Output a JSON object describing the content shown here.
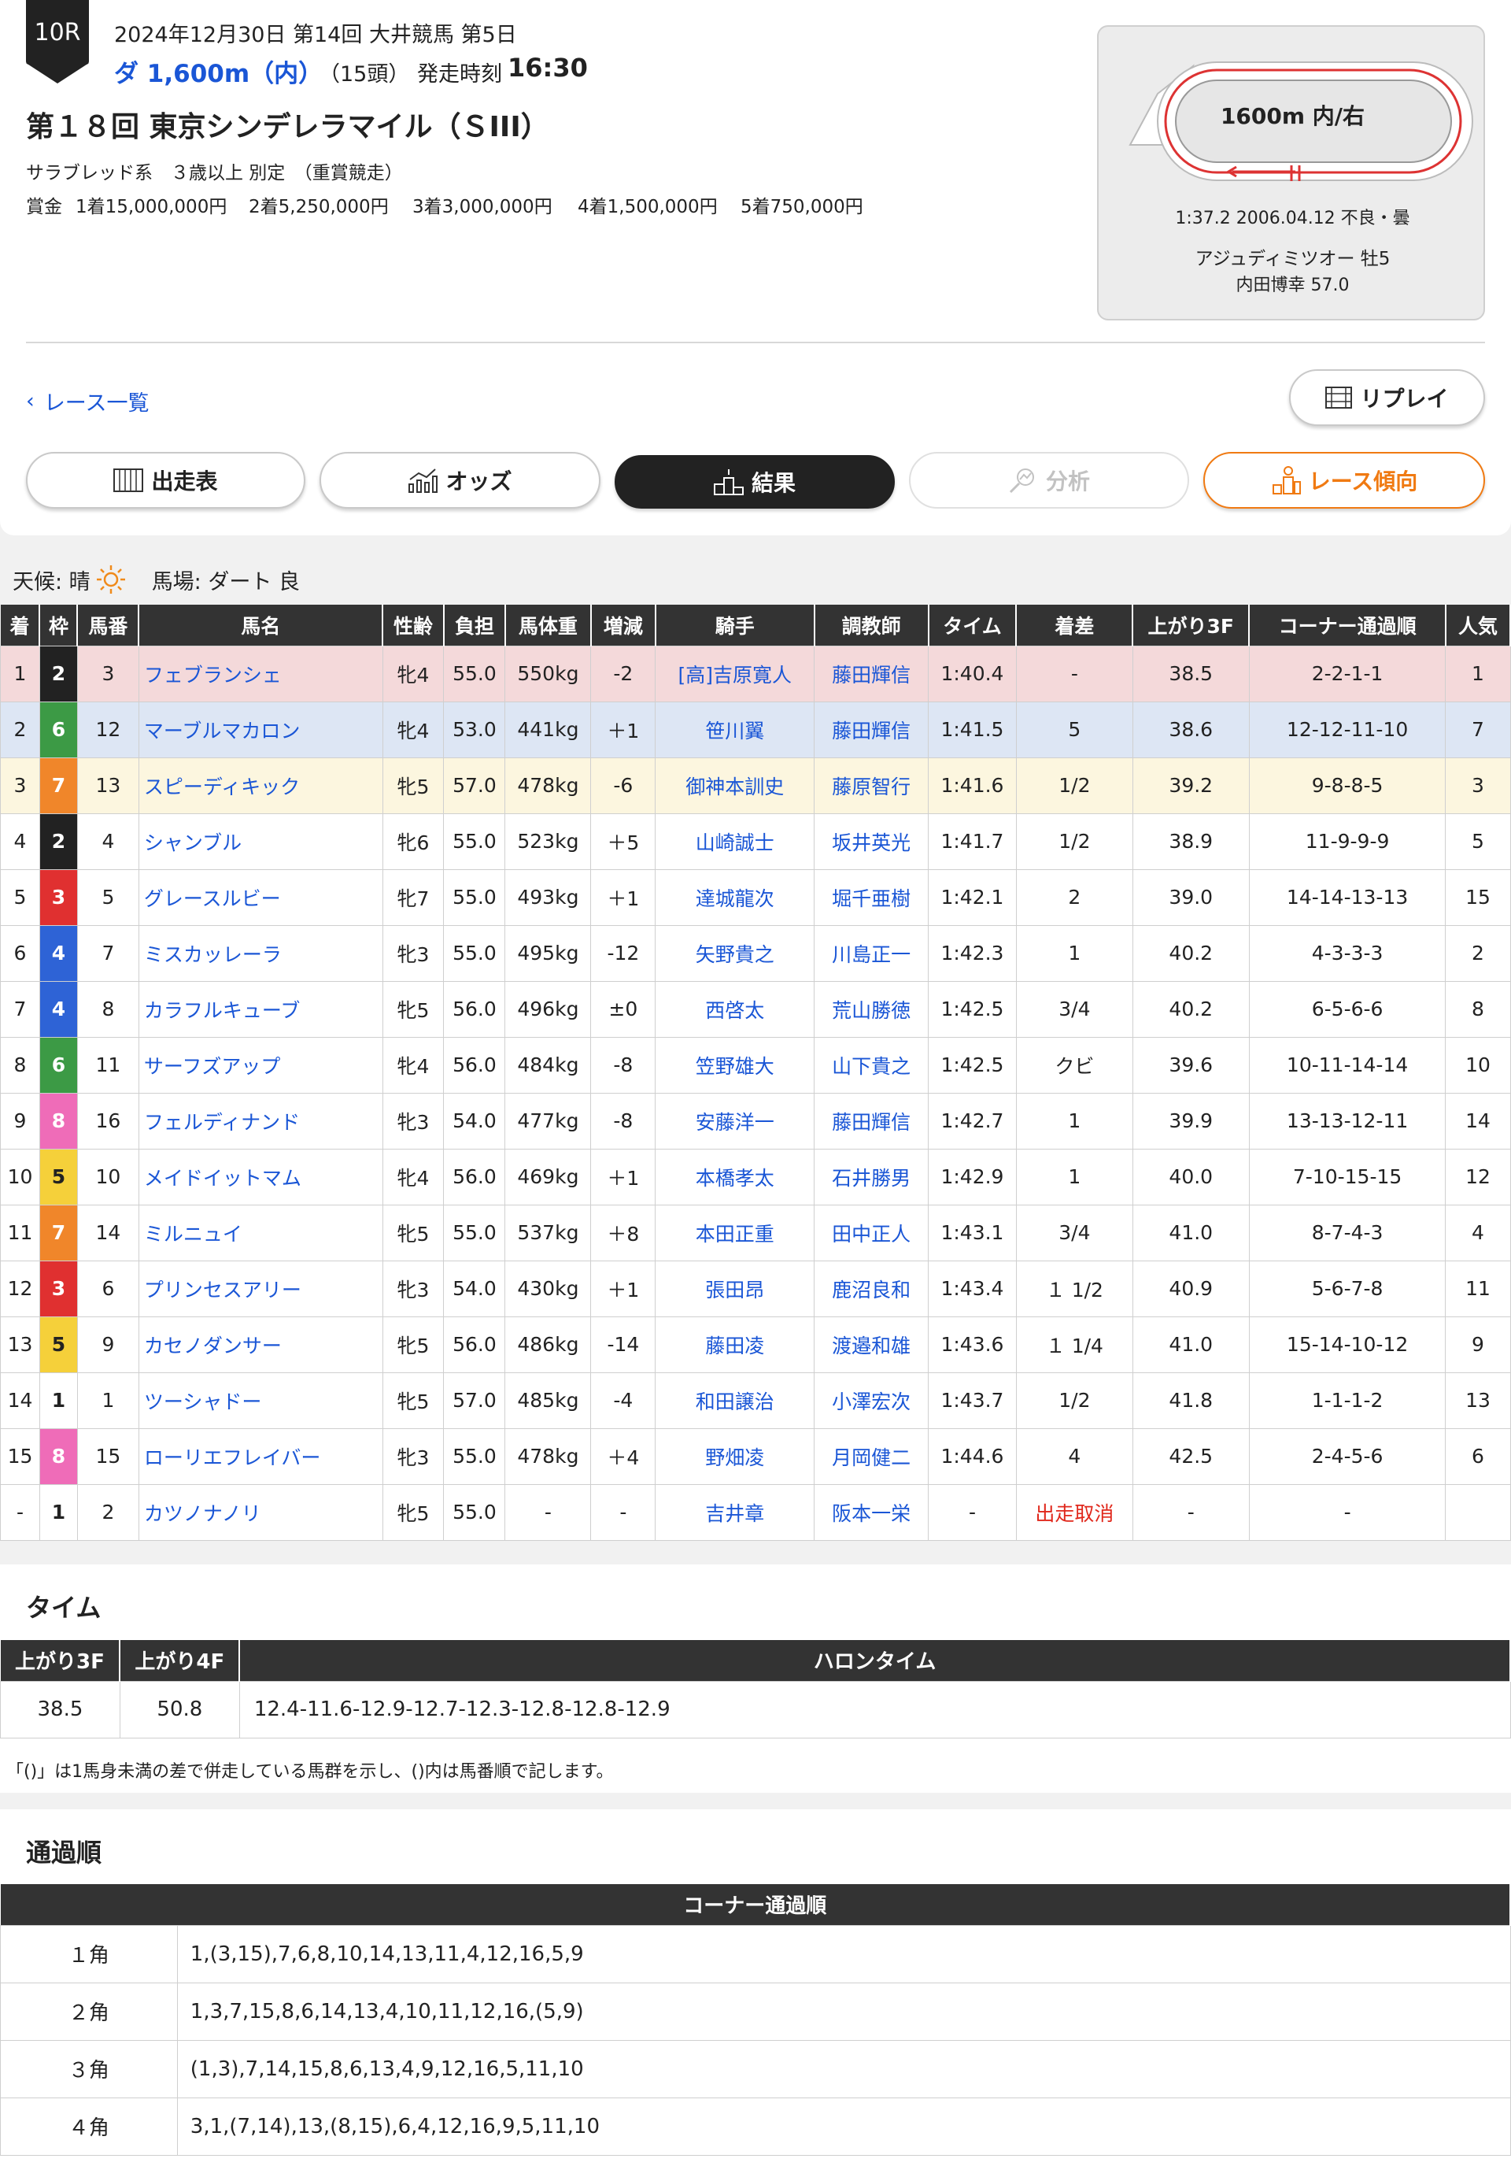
{
  "race": {
    "number": "10R",
    "date_line": "2024年12月30日  第14回 大井競馬 第5日",
    "course": "ダ 1,600m（内）",
    "field_size": "（15頭）",
    "start_label": "発走時刻",
    "start_time": "16:30",
    "title": "第１８回 東京シンデレラマイル（ＳIII）",
    "conditions": "サラブレッド系　３歳以上  別定　（重賞競走）",
    "prize_label": "賞金",
    "prizes": [
      "1着15,000,000円",
      "2着5,250,000円",
      "3着3,000,000円",
      "4着1,500,000円",
      "5着750,000円"
    ]
  },
  "course_record": {
    "track_label": "1600m 内/右",
    "time_line": "1:37.2   2006.04.12   不良・曇",
    "horse_line": "アジュディミツオー   牡5",
    "jockey_line": "内田博幸   57.0"
  },
  "nav": {
    "back_label": "レース一覧",
    "replay_label": "リプレイ",
    "tabs": [
      "出走表",
      "オッズ",
      "結果",
      "分析",
      "レース傾向"
    ]
  },
  "conditions_bar": {
    "weather_label": "天候: 晴",
    "track_label": "馬場: ダート 良"
  },
  "results": {
    "headers": [
      "着",
      "枠",
      "馬番",
      "馬名",
      "性齢",
      "負担",
      "馬体重",
      "増減",
      "騎手",
      "調教師",
      "タイム",
      "着差",
      "上がり3F",
      "コーナー通過順",
      "人気"
    ],
    "rows": [
      [
        "1",
        "2",
        "3",
        "フェブランシェ",
        "牝4",
        "55.0",
        "550kg",
        "-2",
        "[高]吉原寛人",
        "藤田輝信",
        "1:40.4",
        "-",
        "38.5",
        "2-2-1-1",
        "1"
      ],
      [
        "2",
        "6",
        "12",
        "マーブルマカロン",
        "牝4",
        "53.0",
        "441kg",
        "＋1",
        "笹川翼",
        "藤田輝信",
        "1:41.5",
        "5",
        "38.6",
        "12-12-11-10",
        "7"
      ],
      [
        "3",
        "7",
        "13",
        "スピーディキック",
        "牝5",
        "57.0",
        "478kg",
        "-6",
        "御神本訓史",
        "藤原智行",
        "1:41.6",
        "1/2",
        "39.2",
        "9-8-8-5",
        "3"
      ],
      [
        "4",
        "2",
        "4",
        "シャンブル",
        "牝6",
        "55.0",
        "523kg",
        "＋5",
        "山崎誠士",
        "坂井英光",
        "1:41.7",
        "1/2",
        "38.9",
        "11-9-9-9",
        "5"
      ],
      [
        "5",
        "3",
        "5",
        "グレースルビー",
        "牝7",
        "55.0",
        "493kg",
        "＋1",
        "達城龍次",
        "堀千亜樹",
        "1:42.1",
        "2",
        "39.0",
        "14-14-13-13",
        "15"
      ],
      [
        "6",
        "4",
        "7",
        "ミスカッレーラ",
        "牝3",
        "55.0",
        "495kg",
        "-12",
        "矢野貴之",
        "川島正一",
        "1:42.3",
        "1",
        "40.2",
        "4-3-3-3",
        "2"
      ],
      [
        "7",
        "4",
        "8",
        "カラフルキューブ",
        "牝5",
        "56.0",
        "496kg",
        "±0",
        "西啓太",
        "荒山勝徳",
        "1:42.5",
        "3/4",
        "40.2",
        "6-5-6-6",
        "8"
      ],
      [
        "8",
        "6",
        "11",
        "サーフズアップ",
        "牝4",
        "56.0",
        "484kg",
        "-8",
        "笠野雄大",
        "山下貴之",
        "1:42.5",
        "クビ",
        "39.6",
        "10-11-14-14",
        "10"
      ],
      [
        "9",
        "8",
        "16",
        "フェルディナンド",
        "牝3",
        "54.0",
        "477kg",
        "-8",
        "安藤洋一",
        "藤田輝信",
        "1:42.7",
        "1",
        "39.9",
        "13-13-12-11",
        "14"
      ],
      [
        "10",
        "5",
        "10",
        "メイドイットマム",
        "牝4",
        "56.0",
        "469kg",
        "＋1",
        "本橋孝太",
        "石井勝男",
        "1:42.9",
        "1",
        "40.0",
        "7-10-15-15",
        "12"
      ],
      [
        "11",
        "7",
        "14",
        "ミルニュイ",
        "牝5",
        "55.0",
        "537kg",
        "＋8",
        "本田正重",
        "田中正人",
        "1:43.1",
        "3/4",
        "41.0",
        "8-7-4-3",
        "4"
      ],
      [
        "12",
        "3",
        "6",
        "プリンセスアリー",
        "牝3",
        "54.0",
        "430kg",
        "＋1",
        "張田昂",
        "鹿沼良和",
        "1:43.4",
        "１ 1/2",
        "40.9",
        "5-6-7-8",
        "11"
      ],
      [
        "13",
        "5",
        "9",
        "カセノダンサー",
        "牝5",
        "56.0",
        "486kg",
        "-14",
        "藤田凌",
        "渡邉和雄",
        "1:43.6",
        "１ 1/4",
        "41.0",
        "15-14-10-12",
        "9"
      ],
      [
        "14",
        "1",
        "1",
        "ツーシャドー",
        "牝5",
        "57.0",
        "485kg",
        "-4",
        "和田譲治",
        "小澤宏次",
        "1:43.7",
        "1/2",
        "41.8",
        "1-1-1-2",
        "13"
      ],
      [
        "15",
        "8",
        "15",
        "ローリエフレイバー",
        "牝3",
        "55.0",
        "478kg",
        "＋4",
        "野畑凌",
        "月岡健二",
        "1:44.6",
        "4",
        "42.5",
        "2-4-5-6",
        "6"
      ],
      [
        "-",
        "1",
        "2",
        "カツノナノリ",
        "牝5",
        "55.0",
        "-",
        "-",
        "吉井章",
        "阪本一栄",
        "-",
        "出走取消",
        "-",
        "-",
        ""
      ]
    ]
  },
  "time_section": {
    "title": "タイム",
    "headers": [
      "上がり3F",
      "上がり4F",
      "ハロンタイム"
    ],
    "values": [
      "38.5",
      "50.8",
      "12.4-11.6-12.9-12.7-12.3-12.8-12.8-12.9"
    ],
    "note": "「()」は1馬身未満の差で併走している馬群を示し、()内は馬番順で記します。"
  },
  "passing": {
    "title": "通過順",
    "header": "コーナー通過順",
    "rows": [
      {
        "corner": "１角",
        "order": "1,(3,15),7,6,8,10,14,13,11,4,12,16,5,9"
      },
      {
        "corner": "２角",
        "order": "1,3,7,15,8,6,14,13,4,10,11,12,16,(5,9)"
      },
      {
        "corner": "３角",
        "order": "(1,3),7,14,15,8,6,13,4,9,12,16,5,11,10"
      },
      {
        "corner": "４角",
        "order": "3,1,(7,14),13,(8,15),6,4,12,16,9,5,11,10"
      }
    ]
  },
  "colors": {
    "waku": {
      "1": "#ffffff",
      "2": "#222222",
      "3": "#e03030",
      "4": "#2e63d6",
      "5": "#f5d03a",
      "6": "#3c9a45",
      "7": "#f0862a",
      "8": "#ef6cb8"
    },
    "link": "#1a56d6",
    "accent": "#f07a12",
    "scratch": "#e0281c"
  }
}
